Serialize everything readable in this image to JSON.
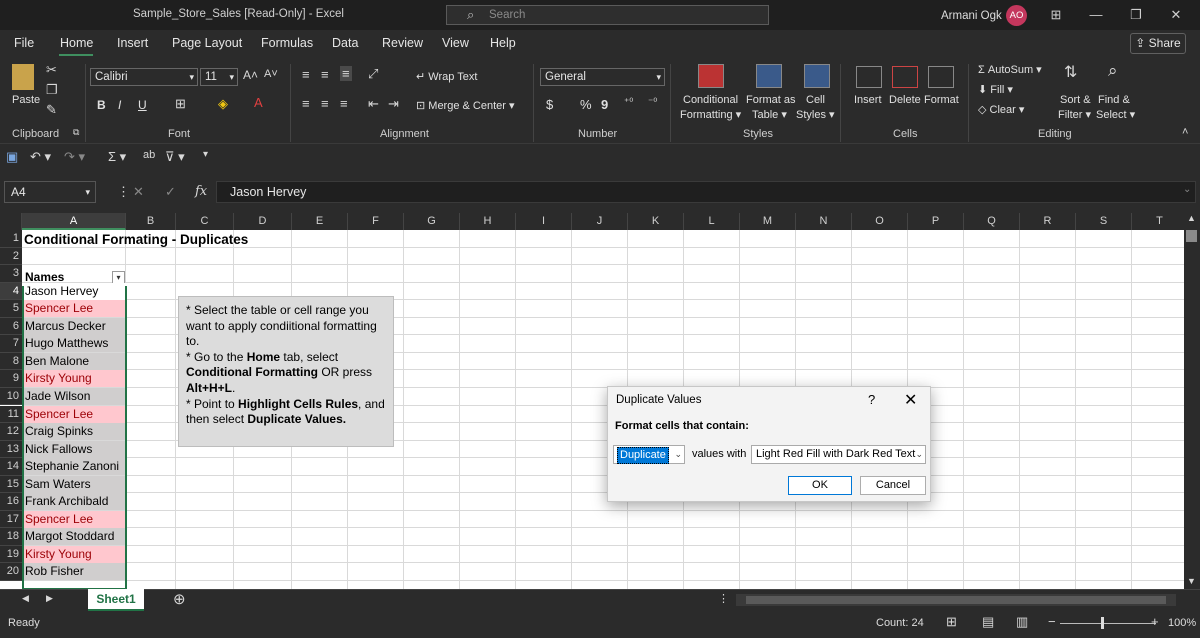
{
  "window": {
    "title": "Sample_Store_Sales  [Read-Only]  -  Excel",
    "search_placeholder": "Search",
    "user_name": "Armani Ogk",
    "user_initials": "AO"
  },
  "menu": {
    "tabs": [
      "File",
      "Home",
      "Insert",
      "Page Layout",
      "Formulas",
      "Data",
      "Review",
      "View",
      "Help"
    ],
    "active": "Home",
    "share_label": "Share"
  },
  "ribbon": {
    "paste_label": "Paste",
    "clipboard_label": "Clipboard",
    "font_name": "Calibri",
    "font_size": "11",
    "font_group_label": "Font",
    "bold": "B",
    "italic": "I",
    "underline": "U",
    "wrap_text": "Wrap Text",
    "merge_center": "Merge & Center",
    "alignment_label": "Alignment",
    "number_format": "General",
    "currency": "$",
    "percent": "%",
    "comma": "9",
    "number_label": "Number",
    "conditional_formatting_1": "Conditional",
    "conditional_formatting_2": "Formatting",
    "format_as_table_1": "Format as",
    "format_as_table_2": "Table",
    "cell_styles_1": "Cell",
    "cell_styles_2": "Styles",
    "styles_label": "Styles",
    "insert": "Insert",
    "delete": "Delete",
    "format": "Format",
    "cells_label": "Cells",
    "autosum": "AutoSum",
    "fill": "Fill",
    "clear": "Clear",
    "sort_filter_1": "Sort &",
    "sort_filter_2": "Filter",
    "find_select_1": "Find &",
    "find_select_2": "Select",
    "editing_label": "Editing"
  },
  "formula_bar": {
    "cell_ref": "A4",
    "fx": "fx",
    "content": "Jason Hervey"
  },
  "columns": [
    "A",
    "B",
    "C",
    "D",
    "E",
    "F",
    "G",
    "H",
    "I",
    "J",
    "K",
    "L",
    "M",
    "N",
    "O",
    "P",
    "Q",
    "R",
    "S",
    "T"
  ],
  "rows": [
    "1",
    "2",
    "3",
    "4",
    "5",
    "6",
    "7",
    "8",
    "9",
    "10",
    "11",
    "12",
    "13",
    "14",
    "15",
    "16",
    "17",
    "18",
    "19",
    "20"
  ],
  "sheet": {
    "title": "Conditional Formating - Duplicates",
    "names_header": "Names",
    "names": [
      {
        "name": "Jason Hervey",
        "dup": false
      },
      {
        "name": "Spencer Lee",
        "dup": true
      },
      {
        "name": "Marcus Decker",
        "dup": false
      },
      {
        "name": "Hugo Matthews",
        "dup": false
      },
      {
        "name": "Ben Malone",
        "dup": false
      },
      {
        "name": "Kirsty Young",
        "dup": true
      },
      {
        "name": "Jade Wilson",
        "dup": false
      },
      {
        "name": "Spencer Lee",
        "dup": true
      },
      {
        "name": "Craig Spinks",
        "dup": false
      },
      {
        "name": "Nick Fallows",
        "dup": false
      },
      {
        "name": "Stephanie Zanoni",
        "dup": false
      },
      {
        "name": "Sam Waters",
        "dup": false
      },
      {
        "name": "Frank Archibald",
        "dup": false
      },
      {
        "name": "Spencer Lee",
        "dup": true
      },
      {
        "name": "Margot Stoddard",
        "dup": false
      },
      {
        "name": "Kirsty Young",
        "dup": true
      },
      {
        "name": "Rob Fisher",
        "dup": false
      }
    ],
    "note": {
      "l1": "* Select the table or cell range you want to apply condiitional formatting to.",
      "l2a": "* Go to the ",
      "l2b": "Home",
      "l2c": " tab, select ",
      "l2d": "Conditional Formatting",
      "l2e": " OR press ",
      "l2f": "Alt+H+L",
      "l2g": ".",
      "l3a": "* Point to ",
      "l3b": "Highlight Cells Rules",
      "l3c": ", and then select ",
      "l3d": "Duplicate Values."
    }
  },
  "dialog": {
    "title": "Duplicate Values",
    "help": "?",
    "close": "✕",
    "label": "Format cells that contain:",
    "type_value": "Duplicate",
    "middle_text": "values with",
    "format_value": "Light Red Fill with Dark Red Text",
    "ok": "OK",
    "cancel": "Cancel"
  },
  "tabs": {
    "sheet_name": "Sheet1"
  },
  "status": {
    "ready": "Ready",
    "count": "Count: 24",
    "zoom": "100%"
  },
  "colors": {
    "excel_green": "#217346",
    "dup_fill": "#ffc7ce",
    "dup_text": "#9c0006",
    "avatar": "#c4375d"
  }
}
